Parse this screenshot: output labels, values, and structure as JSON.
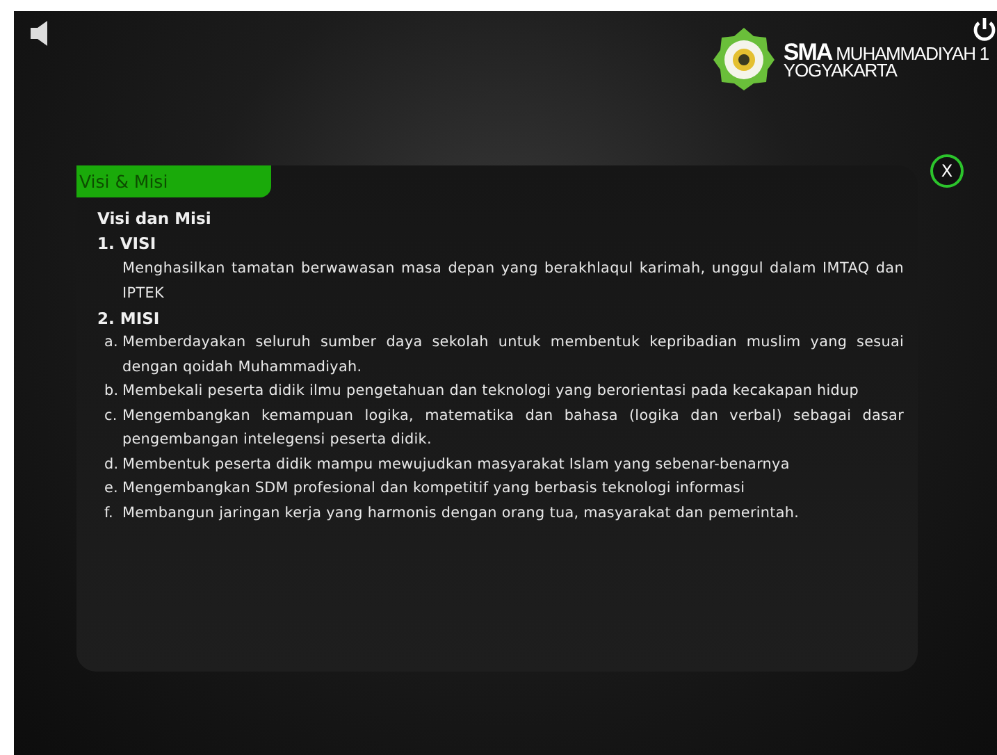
{
  "header": {
    "brand_bold": "SMA",
    "brand_name": "MUHAMMADIYAH 1",
    "brand_city": "YOGYAKARTA"
  },
  "panel": {
    "tab": "Visi & Misi",
    "close": "X",
    "heading": "Visi dan Misi",
    "sections": [
      {
        "kind": "paragraph",
        "number": "1.",
        "title": "VISI",
        "text": "Menghasilkan tamatan berwawasan masa depan yang berakhlaqul karimah, unggul dalam IMTAQ dan IPTEK"
      },
      {
        "kind": "list",
        "number": "2.",
        "title": "MISI",
        "items": [
          {
            "marker": "a.",
            "text": "Memberdayakan seluruh sumber daya sekolah untuk membentuk kepribadian muslim yang sesuai dengan qoidah Muhammadiyah."
          },
          {
            "marker": "b.",
            "text": "Membekali peserta didik ilmu pengetahuan dan teknologi yang berorientasi pada kecakapan hidup"
          },
          {
            "marker": "c.",
            "text": "Mengembangkan kemampuan logika, matematika dan bahasa (logika dan verbal) sebagai dasar pengembangan intelegensi peserta didik."
          },
          {
            "marker": "d.",
            "text": "Membentuk peserta didik mampu mewujudkan masyarakat Islam yang sebenar-benarnya"
          },
          {
            "marker": "e.",
            "text": "Mengembangkan SDM profesional dan kompetitif yang berbasis teknologi informasi"
          },
          {
            "marker": "f.",
            "text": "Membangun jaringan kerja yang harmonis dengan orang tua, masyarakat dan pemerintah."
          }
        ]
      }
    ]
  }
}
